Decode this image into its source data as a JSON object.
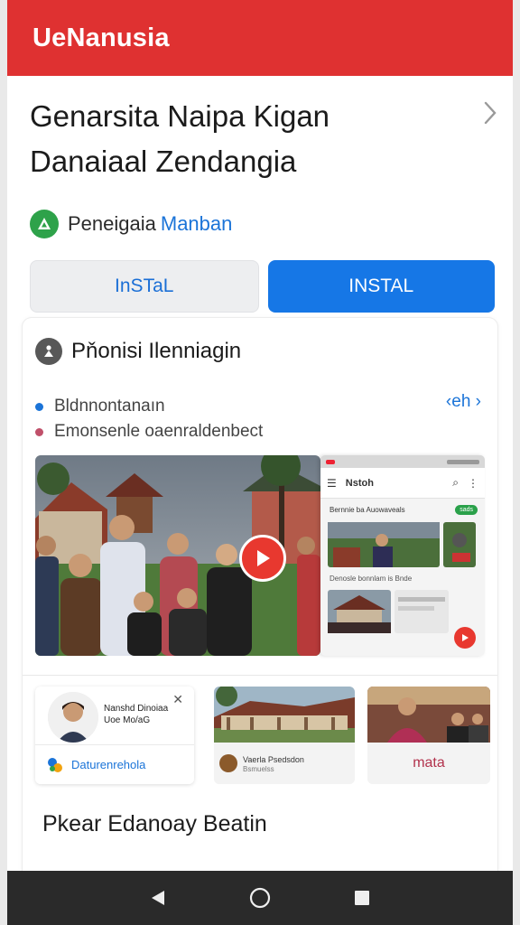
{
  "appbar": {
    "title": "UeNanusia"
  },
  "header": {
    "title_line1": "Genarsita Naipa Kigan",
    "title_line2": "Danaiaal Zendangia",
    "developer_label": "Peneigaia",
    "developer_accent": "Manban"
  },
  "buttons": {
    "secondary": "InSTaL",
    "primary": "INSTAL"
  },
  "card": {
    "title": "Pňonisi Ilenniagin",
    "bullets": [
      "Bldnnontanaın",
      "Emonsenle oaenraldenbect"
    ],
    "bullet_colors": [
      "#1b74d8",
      "#c0506a"
    ],
    "link": "‹eh ›",
    "phone": {
      "bar_title": "Nstoh",
      "row_text": "Bernnie ba Auowaveals",
      "pill": "sads",
      "sub": "Denosle bonnlam is Bnde"
    },
    "tiles": [
      {
        "name": "Nanshd Dinoiaa",
        "name_meta": "Uoe Mo/aG",
        "foot": "Daturenrehola"
      },
      {
        "foot": "Vaerla Psedsdon",
        "foot_sub": "Bsmuelss"
      },
      {
        "foot": "mata"
      }
    ],
    "section_title": "Pkear Edanoay Beatin"
  },
  "colors": {
    "appbar": "#df3131",
    "accent": "#1677e6",
    "play": "#e8382f",
    "developer_badge": "#2ea24a"
  }
}
